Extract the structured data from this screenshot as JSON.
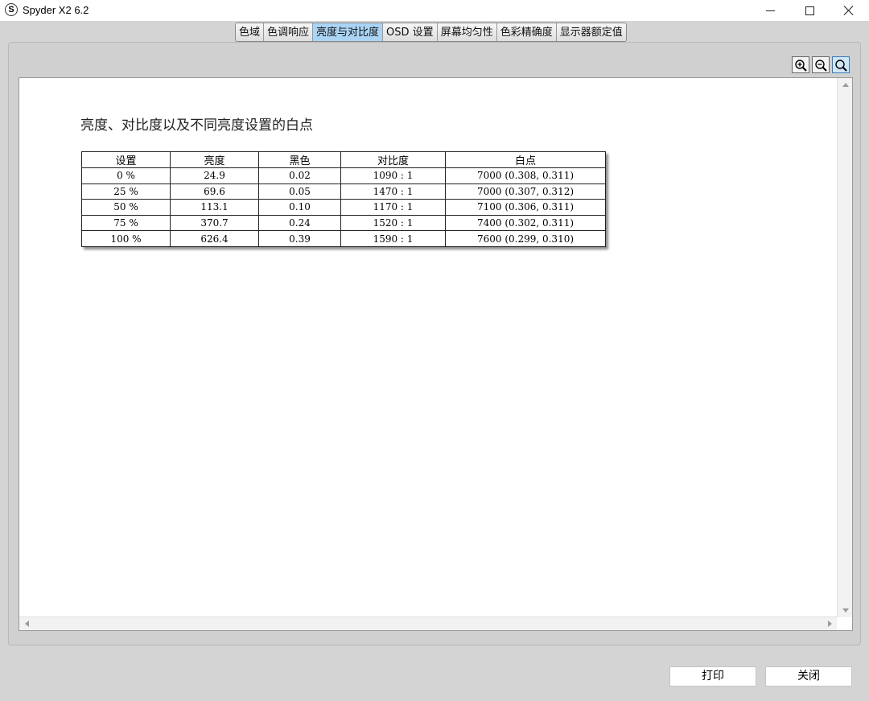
{
  "window": {
    "title": "Spyder X2 6.2",
    "app_icon_letter": "S"
  },
  "tabs": [
    {
      "label": "色域",
      "active": false
    },
    {
      "label": "色调响应",
      "active": false
    },
    {
      "label": "亮度与对比度",
      "active": true
    },
    {
      "label": "OSD 设置",
      "active": false
    },
    {
      "label": "屏幕均匀性",
      "active": false
    },
    {
      "label": "色彩精确度",
      "active": false
    },
    {
      "label": "显示器额定值",
      "active": false
    }
  ],
  "toolbar": {
    "zoom_in_icon": "zoom-in-icon",
    "zoom_out_icon": "zoom-out-icon",
    "zoom_fit_icon": "zoom-reset-icon"
  },
  "report": {
    "title": "亮度、对比度以及不同亮度设置的白点",
    "columns": [
      "设置",
      "亮度",
      "黑色",
      "对比度",
      "白点"
    ],
    "rows": [
      [
        "0 %",
        "24.9",
        "0.02",
        "1090 : 1",
        "7000 (0.308, 0.311)"
      ],
      [
        "25 %",
        "69.6",
        "0.05",
        "1470 : 1",
        "7000 (0.307, 0.312)"
      ],
      [
        "50 %",
        "113.1",
        "0.10",
        "1170 : 1",
        "7100 (0.306, 0.311)"
      ],
      [
        "75 %",
        "370.7",
        "0.24",
        "1520 : 1",
        "7400 (0.302, 0.311)"
      ],
      [
        "100 %",
        "626.4",
        "0.39",
        "1590 : 1",
        "7600 (0.299, 0.310)"
      ]
    ]
  },
  "buttons": {
    "print": "打印",
    "close": "关闭"
  },
  "colors": {
    "active_tab": "#aad4f5",
    "background": "#d4d4d4"
  }
}
